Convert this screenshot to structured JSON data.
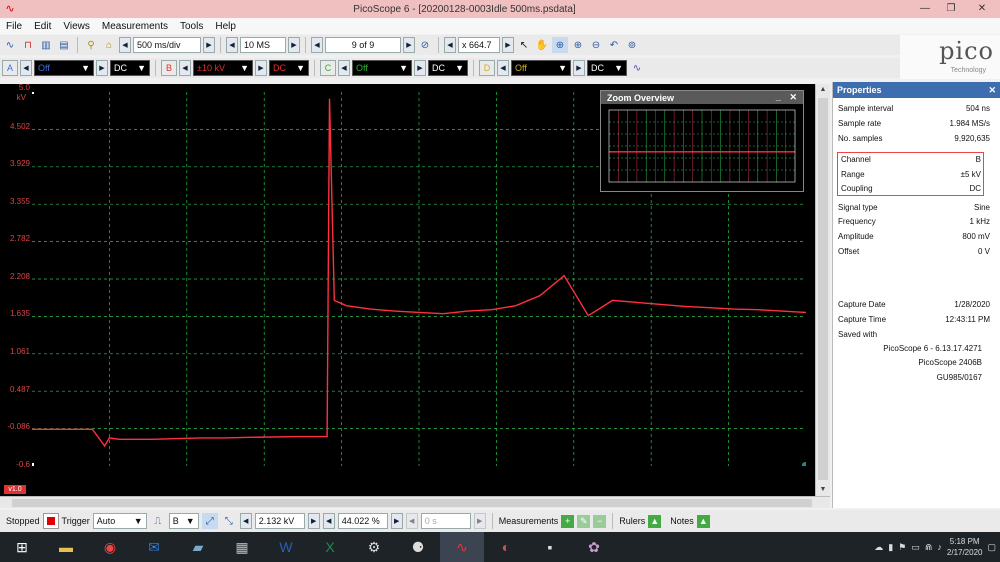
{
  "window": {
    "title": "PicoScope 6 - [20200128-0003Idle 500ms.psdata]"
  },
  "menu": [
    "File",
    "Edit",
    "Views",
    "Measurements",
    "Tools",
    "Help"
  ],
  "toolbar": {
    "timebase": "500 ms/div",
    "samples": "10 MS",
    "buffer": "9 of 9",
    "zoom": "x 664.7"
  },
  "channels": [
    {
      "letter": "A",
      "range": "Off",
      "coupling": "DC",
      "color": "#3a6fd8"
    },
    {
      "letter": "B",
      "range": "±10 kV",
      "coupling": "DC",
      "color": "#e03030"
    },
    {
      "letter": "C",
      "range": "Off",
      "coupling": "DC",
      "color": "#2fb02f"
    },
    {
      "letter": "D",
      "range": "Off",
      "coupling": "DC",
      "color": "#d0b020"
    }
  ],
  "logo": {
    "word": "pico",
    "sub": "Technology"
  },
  "yaxis": {
    "unit": "kV",
    "ticks": [
      "5.0",
      "4.502",
      "3.929",
      "3.355",
      "2.782",
      "2.208",
      "1.635",
      "1.061",
      "0.487",
      "-0.086",
      "-0.6"
    ]
  },
  "chart_data": {
    "type": "line",
    "ylim": [
      -0.6,
      5.0
    ],
    "grid": true,
    "series": [
      {
        "color": "#ff3040",
        "x": [
          0,
          2.5,
          3.0,
          3.2,
          3.6,
          4.0,
          5.0,
          6.0,
          7.0,
          8.0,
          9.0,
          11.0,
          12.0,
          12.2,
          12.3,
          12.5,
          13.0,
          14.0,
          15.0,
          16.0,
          17.0,
          18.0,
          19.0,
          20.0,
          21.0,
          22.0,
          23.0,
          24.0,
          25.0,
          26.0,
          27.0,
          28.0,
          29.0,
          30.0,
          31.0,
          32.0
        ],
        "y": [
          -0.05,
          -0.05,
          -0.3,
          -0.18,
          -0.2,
          -0.2,
          -0.2,
          -0.19,
          -0.18,
          -0.18,
          -0.17,
          -0.16,
          -0.16,
          -0.16,
          4.9,
          1.88,
          1.8,
          1.75,
          1.72,
          1.7,
          1.68,
          1.72,
          1.74,
          1.8,
          1.95,
          2.25,
          1.65,
          1.88,
          1.85,
          1.82,
          1.79,
          1.77,
          1.75,
          1.74,
          1.72,
          1.7
        ]
      }
    ],
    "overview_series": [
      {
        "x": [
          0,
          1
        ],
        "y": [
          0.25,
          0.25
        ]
      }
    ]
  },
  "zoom_overview": {
    "title": "Zoom Overview",
    "min": "_",
    "close": "✕"
  },
  "channel_badge": "v1.0",
  "properties": {
    "title": "Properties",
    "rows": [
      {
        "k": "Sample interval",
        "v": "504 ns"
      },
      {
        "k": "Sample rate",
        "v": "1.984 MS/s"
      },
      {
        "k": "No. samples",
        "v": "9,920,635"
      },
      {
        "k": "Channel",
        "v": "B"
      },
      {
        "k": "Range",
        "v": "±5 kV"
      },
      {
        "k": "Coupling",
        "v": "DC"
      },
      {
        "k": "Signal type",
        "v": "Sine"
      },
      {
        "k": "Frequency",
        "v": "1 kHz"
      },
      {
        "k": "Amplitude",
        "v": "800 mV"
      },
      {
        "k": "Offset",
        "v": "0 V"
      },
      {
        "k": "Capture Date",
        "v": "1/28/2020"
      },
      {
        "k": "Capture Time",
        "v": "12:43:11 PM"
      },
      {
        "k": "Saved with",
        "v": ""
      }
    ],
    "saved_with": [
      "PicoScope 6 - 6.13.17.4271",
      "PicoScope 2406B",
      "GU985/0167"
    ]
  },
  "bottom": {
    "status": "Stopped",
    "trigger_label": "Trigger",
    "trigger_mode": "Auto",
    "trigger_channel": "B",
    "trigger_level": "2.132 kV",
    "pre_trigger": "44.022 %",
    "delay": "0 s",
    "measurements": "Measurements",
    "rulers": "Rulers",
    "notes": "Notes"
  },
  "taskbar": {
    "time": "5:18 PM",
    "date": "2/17/2020"
  }
}
